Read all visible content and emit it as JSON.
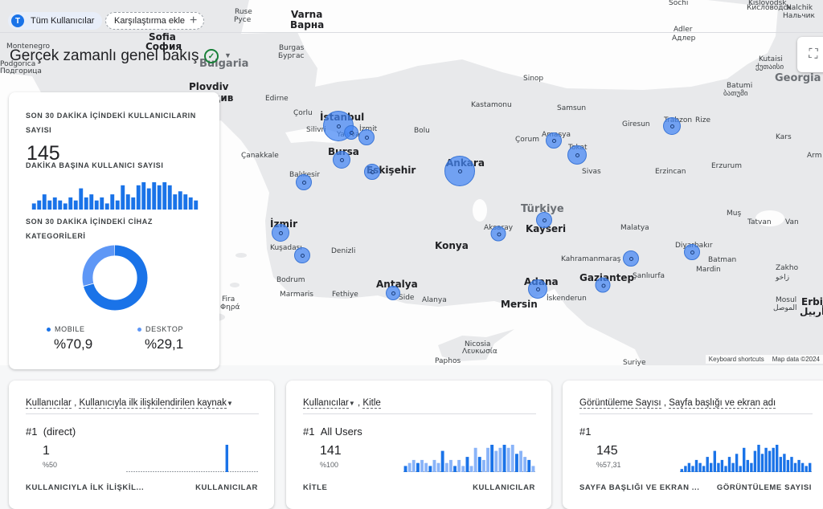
{
  "filters": {
    "user_chip": {
      "avatar_letter": "T",
      "label": "Tüm Kullanıcılar"
    },
    "compare_chip": {
      "label": "Karşılaştırma ekle"
    }
  },
  "page_title": "Gerçek zamanlı genel bakış",
  "map": {
    "labels": [
      {
        "id": "sochi",
        "text": "Sochi",
        "big": false
      },
      {
        "id": "kislovodsk",
        "text": "Kislovodsk",
        "big": false
      },
      {
        "id": "kislovodsk_ru",
        "text": "Кисловодск",
        "big": false
      },
      {
        "id": "nalchik",
        "text": "Nalchik",
        "big": false
      },
      {
        "id": "nalchik_ru",
        "text": "Нальчик",
        "big": false
      },
      {
        "id": "adler",
        "text": "Adler",
        "big": false
      },
      {
        "id": "adler_ru",
        "text": "Адлер",
        "big": false
      },
      {
        "id": "ruse",
        "text": "Ruse",
        "big": false
      },
      {
        "id": "ruse_bg",
        "text": "Русе",
        "big": false
      },
      {
        "id": "varna",
        "text": "Varna",
        "big": true
      },
      {
        "id": "varna_bg",
        "text": "Варна",
        "big": true
      },
      {
        "id": "sofia",
        "text": "Sofia",
        "big": true
      },
      {
        "id": "sofia_bg",
        "text": "София",
        "big": true
      },
      {
        "id": "montenegro",
        "text": "Montenegro",
        "big": false
      },
      {
        "id": "podgorica",
        "text": "Podgorica",
        "big": false
      },
      {
        "id": "podgorica_cy",
        "text": "Подгорица",
        "big": false
      },
      {
        "id": "burgas",
        "text": "Burgas",
        "big": false
      },
      {
        "id": "burgas_bg",
        "text": "Бургас",
        "big": false
      },
      {
        "id": "bulgaria",
        "text": "Bulgaria",
        "big": false
      },
      {
        "id": "plovdiv",
        "text": "Plovdiv",
        "big": true
      },
      {
        "id": "plovdiv_bg",
        "text": "Пловдив",
        "big": true
      },
      {
        "id": "kutaisi",
        "text": "Kutaisi",
        "big": false
      },
      {
        "id": "kutaisi_ka",
        "text": "ქუთაისი",
        "big": false
      },
      {
        "id": "georgia",
        "text": "Georgia",
        "big": false
      },
      {
        "id": "batumi",
        "text": "Batumi",
        "big": false
      },
      {
        "id": "batumi_ka",
        "text": "ბათუმი",
        "big": false
      },
      {
        "id": "sinop",
        "text": "Sinop",
        "big": false
      },
      {
        "id": "edirne",
        "text": "Edirne",
        "big": false
      },
      {
        "id": "corlu",
        "text": "Çorlu",
        "big": false
      },
      {
        "id": "istanbul",
        "text": "İstanbul",
        "big": true
      },
      {
        "id": "silivri",
        "text": "Silivri",
        "big": false
      },
      {
        "id": "izmit",
        "text": "İzmit",
        "big": false
      },
      {
        "id": "yalova",
        "text": "Yalova",
        "big": false
      },
      {
        "id": "kastamonu",
        "text": "Kastamonu",
        "big": false
      },
      {
        "id": "samsun",
        "text": "Samsun",
        "big": false
      },
      {
        "id": "giresun",
        "text": "Giresun",
        "big": false
      },
      {
        "id": "trabzon",
        "text": "Trabzon",
        "big": false
      },
      {
        "id": "rize",
        "text": "Rize",
        "big": false
      },
      {
        "id": "bolu",
        "text": "Bolu",
        "big": false
      },
      {
        "id": "corum",
        "text": "Çorum",
        "big": false
      },
      {
        "id": "amasya",
        "text": "Amasya",
        "big": false
      },
      {
        "id": "canakkale",
        "text": "Çanakkale",
        "big": false
      },
      {
        "id": "bursa",
        "text": "Bursa",
        "big": true
      },
      {
        "id": "tokat",
        "text": "Tokat",
        "big": false
      },
      {
        "id": "kars",
        "text": "Kars",
        "big": false
      },
      {
        "id": "eskisehir",
        "text": "Eskişehir",
        "big": true
      },
      {
        "id": "ankara",
        "text": "Ankara",
        "big": true
      },
      {
        "id": "balikesir",
        "text": "Balıkesir",
        "big": false
      },
      {
        "id": "sivas",
        "text": "Sivas",
        "big": false
      },
      {
        "id": "erzincan",
        "text": "Erzincan",
        "big": false
      },
      {
        "id": "erzurum",
        "text": "Erzurum",
        "big": false
      },
      {
        "id": "arm",
        "text": "Arm",
        "big": false
      },
      {
        "id": "turkiye",
        "text": "Türkiye",
        "big": false
      },
      {
        "id": "izmir",
        "text": "İzmir",
        "big": true
      },
      {
        "id": "mus",
        "text": "Muş",
        "big": false
      },
      {
        "id": "aksaray",
        "text": "Aksaray",
        "big": false
      },
      {
        "id": "kayseri",
        "text": "Kayseri",
        "big": true
      },
      {
        "id": "tatvan",
        "text": "Tatvan",
        "big": false
      },
      {
        "id": "van",
        "text": "Van",
        "big": false
      },
      {
        "id": "malatya",
        "text": "Malatya",
        "big": false
      },
      {
        "id": "konya",
        "text": "Konya",
        "big": true
      },
      {
        "id": "kusadasi",
        "text": "Kuşadası",
        "big": false
      },
      {
        "id": "denizli",
        "text": "Denizli",
        "big": false
      },
      {
        "id": "diyarbakir",
        "text": "Diyarbakır",
        "big": false
      },
      {
        "id": "kahramanmaras",
        "text": "Kahramanmaraş",
        "big": false
      },
      {
        "id": "batman",
        "text": "Batman",
        "big": false
      },
      {
        "id": "mardin",
        "text": "Mardin",
        "big": false
      },
      {
        "id": "bodrum",
        "text": "Bodrum",
        "big": false
      },
      {
        "id": "gaziantep",
        "text": "Gaziantep",
        "big": true
      },
      {
        "id": "sanliurfa",
        "text": "Şanlıurfa",
        "big": false
      },
      {
        "id": "antalya",
        "text": "Antalya",
        "big": true
      },
      {
        "id": "adana",
        "text": "Adana",
        "big": true
      },
      {
        "id": "marmaris",
        "text": "Marmaris",
        "big": false
      },
      {
        "id": "fethiye",
        "text": "Fethiye",
        "big": false
      },
      {
        "id": "side",
        "text": "Side",
        "big": false
      },
      {
        "id": "alanya",
        "text": "Alanya",
        "big": false
      },
      {
        "id": "mersin",
        "text": "Mersin",
        "big": true
      },
      {
        "id": "iskenderun",
        "text": "İskenderun",
        "big": false
      },
      {
        "id": "zakho",
        "text": "Zakho",
        "big": false
      },
      {
        "id": "zakho_ar",
        "text": "زاخو",
        "big": false
      },
      {
        "id": "mosul",
        "text": "Mosul",
        "big": false
      },
      {
        "id": "mosul_ar",
        "text": "الموصل",
        "big": false
      },
      {
        "id": "erbil",
        "text": "Erbil",
        "big": true
      },
      {
        "id": "erbil_ar",
        "text": "أربيل",
        "big": true
      },
      {
        "id": "fira",
        "text": "Fira",
        "big": false
      },
      {
        "id": "fira_gr",
        "text": "Φηρά",
        "big": false
      },
      {
        "id": "nicosia",
        "text": "Nicosia",
        "big": false
      },
      {
        "id": "nicosia_gr",
        "text": "Λευκωσία",
        "big": false
      },
      {
        "id": "paphos",
        "text": "Paphos",
        "big": false
      },
      {
        "id": "suriye",
        "text": "Suriye",
        "big": false
      }
    ],
    "bubble_ids": [
      "istanbul",
      "izmit",
      "yalova",
      "bursa",
      "balikesir",
      "eskisehir",
      "ankara",
      "amasya",
      "tokat",
      "trabzon",
      "izmir",
      "kusadasi",
      "kayseri",
      "aksaray",
      "adana",
      "antalya",
      "gaziantep",
      "kahramanmaras",
      "diyarbakir"
    ],
    "credits": {
      "shortcuts": "Keyboard shortcuts",
      "mapdata": "Map data ©2024"
    }
  },
  "realtime_card": {
    "users_caption": "SON 30 DAKİKA İÇİNDEKİ KULLANICILARIN SAYISI",
    "users_value": "145",
    "per_minute_caption": "DAKİKA BAŞINA KULLANICI SAYISI",
    "per_minute_values": [
      2,
      3,
      5,
      3,
      4,
      3,
      2,
      4,
      3,
      7,
      4,
      5,
      3,
      4,
      2,
      5,
      3,
      8,
      5,
      4,
      8,
      9,
      7,
      9,
      8,
      9,
      8,
      5,
      6,
      5,
      4,
      3
    ],
    "device_caption": "SON 30 DAKİKA İÇİNDEKİ CİHAZ KATEGORİLERİ",
    "devices": [
      {
        "label": "MOBILE",
        "value": "%70,9",
        "share": 0.709,
        "color": "#1a73e8"
      },
      {
        "label": "DESKTOP",
        "value": "%29,1",
        "share": 0.291,
        "color": "#5e97f6"
      }
    ]
  },
  "cards": [
    {
      "metric": "Kullanıcılar",
      "dimension": "Kullanıcıyla ilk ilişkilendirilen kaynak",
      "rank": "#1",
      "top_label": "(direct)",
      "top_value": "1",
      "top_pct": "%50",
      "spark": [
        0,
        0,
        0,
        0,
        0,
        0,
        0,
        0,
        0,
        0,
        0,
        0,
        0,
        0,
        0,
        0,
        0,
        0,
        0,
        0,
        0,
        0,
        0,
        0,
        0,
        0,
        0,
        10,
        0,
        0,
        0,
        0,
        0,
        0,
        0,
        0
      ],
      "col_left": "KULLANICIYLA İLK İLİŞKİL...",
      "col_right": "KULLANICILAR"
    },
    {
      "metric": "Kullanıcılar",
      "dimension": "Kitle",
      "rank": "#1",
      "top_label": "All Users",
      "top_value": "141",
      "top_pct": "%100",
      "spark": [
        2,
        3,
        4,
        3,
        4,
        3,
        2,
        4,
        3,
        7,
        3,
        4,
        2,
        4,
        2,
        5,
        2,
        8,
        5,
        4,
        8,
        9,
        7,
        8,
        9,
        8,
        9,
        6,
        7,
        5,
        4,
        2
      ],
      "col_left": "KİTLE",
      "col_right": "KULLANICILAR"
    },
    {
      "metric": "Görüntüleme Sayısı",
      "dimension": "Sayfa başlığı ve ekran adı",
      "rank": "#1",
      "top_label": "",
      "top_value": "145",
      "top_pct": "%57,31",
      "spark": [
        1,
        2,
        3,
        2,
        4,
        3,
        2,
        5,
        3,
        7,
        3,
        4,
        2,
        5,
        3,
        6,
        2,
        8,
        4,
        3,
        7,
        9,
        6,
        8,
        7,
        8,
        9,
        5,
        6,
        4,
        5,
        3,
        4,
        3,
        2,
        3
      ],
      "col_left": "SAYFA BAŞLIĞI VE EKRAN ...",
      "col_right": "GÖRÜNTÜLEME SAYISI"
    }
  ]
}
